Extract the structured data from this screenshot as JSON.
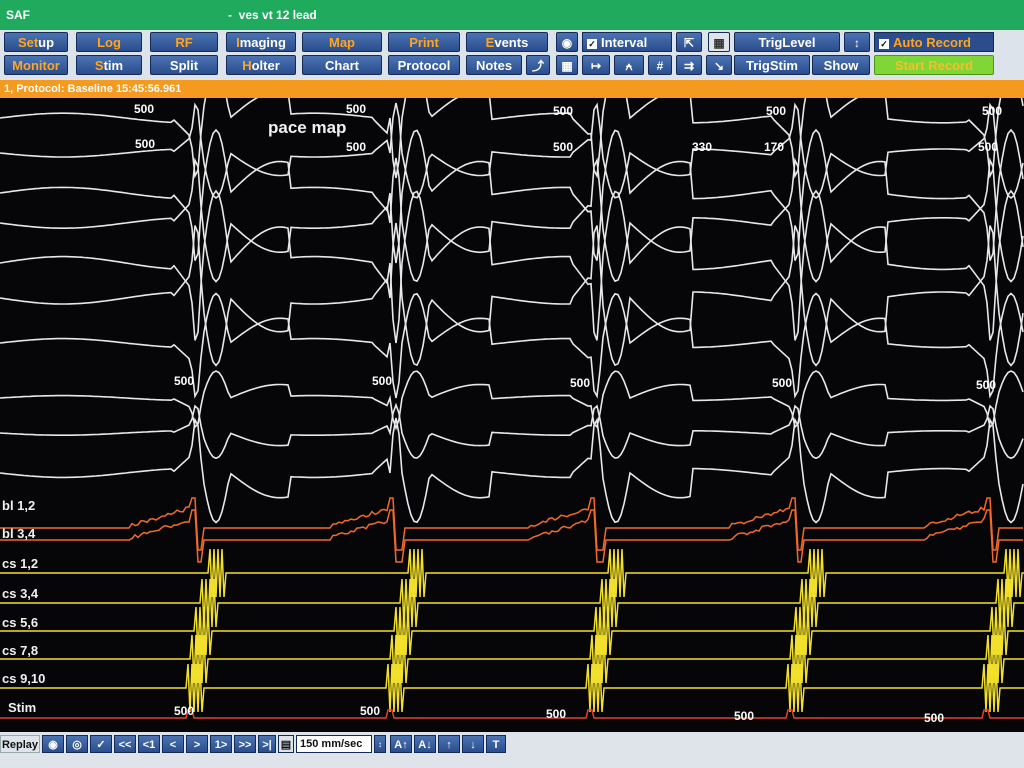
{
  "window": {
    "app_name": "SAF",
    "title": "ves vt 12 lead"
  },
  "toolbar": {
    "row1": [
      {
        "label": "Setup",
        "hot": "Set",
        "rest": "up"
      },
      {
        "label": "Log",
        "hot": "Log",
        "rest": ""
      },
      {
        "label": "RF",
        "hot": "RF",
        "rest": ""
      },
      {
        "label": "Imaging",
        "hot": "I",
        "rest": "maging"
      },
      {
        "label": "Map",
        "hot": "Map",
        "rest": ""
      },
      {
        "label": "Print",
        "hot": "Print",
        "rest": ""
      },
      {
        "label": "Events",
        "hot": "E",
        "rest": "vents"
      }
    ],
    "row2": [
      {
        "label": "Monitor",
        "hot": "Monitor",
        "rest": ""
      },
      {
        "label": "Stim",
        "hot": "S",
        "rest": "tim"
      },
      {
        "label": "Split",
        "hot": "",
        "rest": "Split"
      },
      {
        "label": "Holter",
        "hot": "H",
        "rest": "olter"
      },
      {
        "label": "Chart",
        "hot": "",
        "rest": "Chart"
      },
      {
        "label": "Protocol",
        "hot": "",
        "rest": "Protocol"
      },
      {
        "label": "Notes",
        "hot": "",
        "rest": "Notes"
      }
    ],
    "interval_label": "Interval",
    "interval_checked": true,
    "trig_level_label": "TrigLevel",
    "trig_stim_label": "TrigStim",
    "show_label": "Show",
    "auto_record_label": "Auto Record",
    "auto_record_checked": true,
    "start_record_label": "Start Record",
    "icons": [
      "camera-icon",
      "grid-icon",
      "caliper-icon",
      "marching-caliper-icon",
      "hash-icon",
      "cursor-icon",
      "calculator-icon",
      "zoom-icon",
      "up-down-arrow-icon",
      "syringe-icon",
      "measure-icon"
    ]
  },
  "status": {
    "text": "1, Protocol: Baseline   15:45:56.961"
  },
  "annotation": {
    "pace_map": "pace map"
  },
  "channels": {
    "abl12": "bl 1,2",
    "abl34": "bl 3,4",
    "cs12": "cs 1,2",
    "cs34": "cs 3,4",
    "cs56": "cs 5,6",
    "cs78": "cs 7,8",
    "cs910": "cs 9,10",
    "stim": "Stim"
  },
  "intervals": {
    "top_row": [
      "500",
      "500",
      "500",
      "500",
      "500"
    ],
    "second_row": [
      "500",
      "500",
      "500",
      "330",
      "170",
      "500"
    ],
    "mid_row": [
      "500",
      "500",
      "500",
      "500",
      "500"
    ],
    "stim_row": [
      "500",
      "500",
      "500",
      "500",
      "500"
    ]
  },
  "footer": {
    "replay_label": "Replay",
    "nav_buttons": [
      "<<",
      "<1",
      "<",
      ">",
      "1>",
      ">>",
      ">|"
    ],
    "speed": "150 mm/sec",
    "amp_buttons": [
      "A↑",
      "A↓",
      "↑",
      "↓",
      "T"
    ]
  },
  "colors": {
    "title_bar": "#1faa5e",
    "status_bar": "#f39a1f",
    "trace_surface": "#e8e8e8",
    "trace_ablation": "#f26a2a",
    "trace_cs": "#f2e02b",
    "trace_stim": "#e8402a"
  }
}
